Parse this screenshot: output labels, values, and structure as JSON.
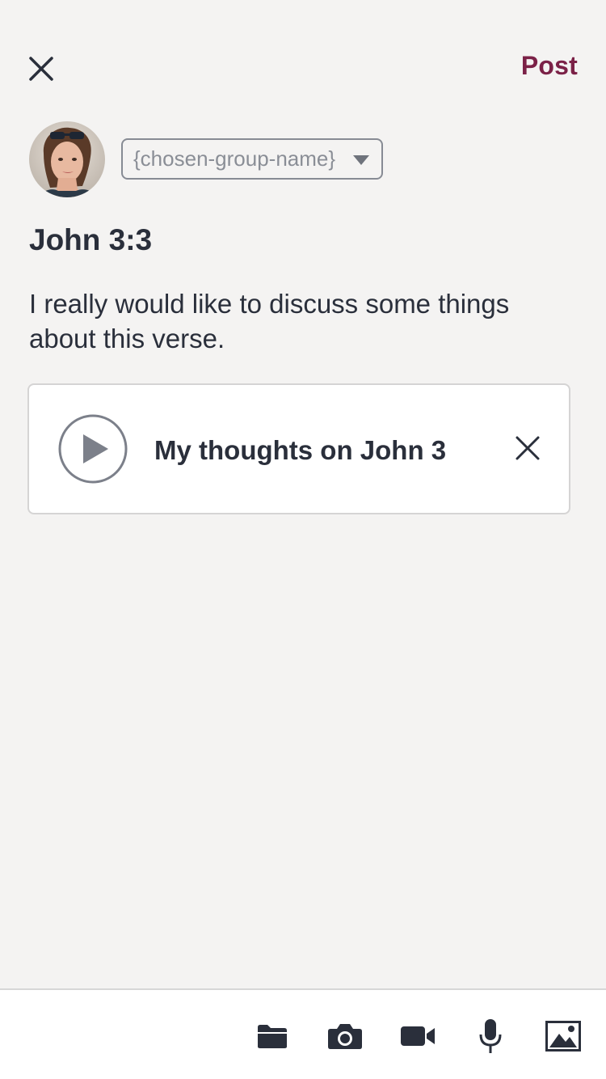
{
  "header": {
    "close_icon": "close-icon",
    "post_label": "Post",
    "accent_color": "#7b2147"
  },
  "composer": {
    "group_select": {
      "value": "{chosen-group-name}",
      "icon": "caret-down-icon"
    },
    "title": "John 3:3",
    "body": "I really would like to discuss some things about this verse.",
    "attachment": {
      "type_icon": "play-icon",
      "title": "My thoughts on John 3",
      "remove_icon": "close-icon"
    }
  },
  "toolbar": {
    "items": [
      {
        "icon": "folder-icon"
      },
      {
        "icon": "camera-icon"
      },
      {
        "icon": "video-camera-icon"
      },
      {
        "icon": "microphone-icon"
      },
      {
        "icon": "image-icon"
      }
    ]
  }
}
